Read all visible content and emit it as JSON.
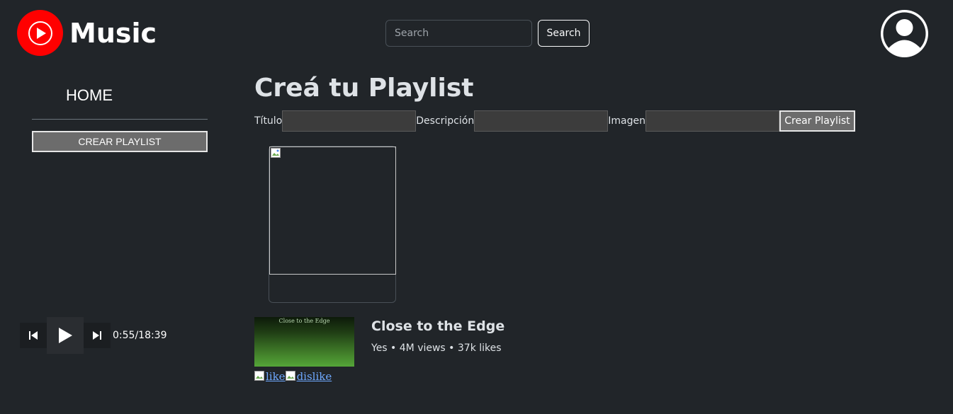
{
  "header": {
    "logo_text": "Music",
    "search": {
      "placeholder": "Search",
      "value": ""
    },
    "search_button_label": "Search"
  },
  "sidebar": {
    "home_label": "HOME",
    "create_playlist_label": "CREAR PLAYLIST"
  },
  "player": {
    "time": "0:55/18:39"
  },
  "main": {
    "title": "Creá tu Playlist",
    "form": {
      "title_label": "Título",
      "description_label": "Descripción",
      "image_label": "Imagen",
      "submit_label": "Crear Playlist"
    },
    "song": {
      "thumbnail_text": "Close to the Edge",
      "title": "Close to the Edge",
      "meta": "Yes • 4M views • 37k likes",
      "like_alt": "like",
      "dislike_alt": "dislike"
    }
  },
  "colors": {
    "background": "#212529",
    "brand_red": "#ff0000",
    "link_blue": "#6ea8fe"
  }
}
